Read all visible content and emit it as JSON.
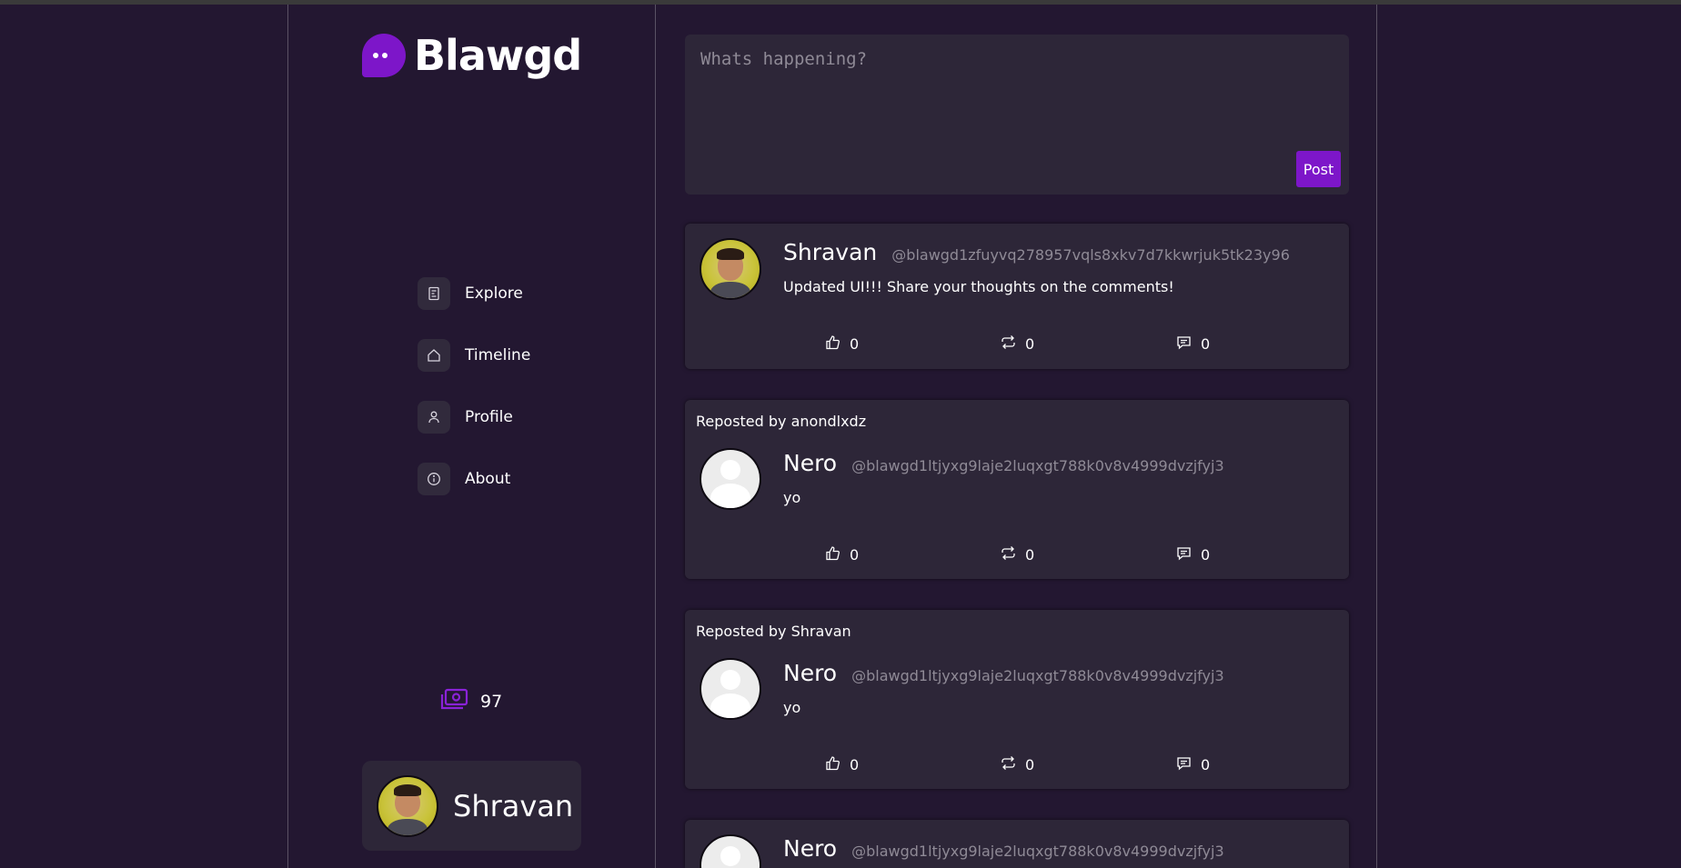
{
  "app": {
    "name": "Blawgd",
    "brand_color": "#7d16c9",
    "background": "#231731"
  },
  "sidebar": {
    "items": [
      {
        "label": "Explore",
        "icon": "explore-icon"
      },
      {
        "label": "Timeline",
        "icon": "home-icon"
      },
      {
        "label": "Profile",
        "icon": "user-icon"
      },
      {
        "label": "About",
        "icon": "info-icon"
      }
    ],
    "coins": {
      "icon": "money-icon",
      "value": "97"
    },
    "user": {
      "name": "Shravan"
    }
  },
  "composer": {
    "placeholder": "Whats happening?",
    "post_label": "Post"
  },
  "feed": [
    {
      "reposted_by": "",
      "name": "Shravan",
      "handle": "@blawgd1zfuyvq278957vqls8xkv7d7kkwrjuk5tk23y96",
      "text": "Updated UI!!! Share your thoughts on the comments!",
      "likes": "0",
      "reposts": "0",
      "comments": "0"
    },
    {
      "reposted_by": "Reposted by anondlxdz",
      "name": "Nero",
      "handle": "@blawgd1ltjyxg9laje2luqxgt788k0v8v4999dvzjfyj3",
      "text": "yo",
      "likes": "0",
      "reposts": "0",
      "comments": "0"
    },
    {
      "reposted_by": "Reposted by Shravan",
      "name": "Nero",
      "handle": "@blawgd1ltjyxg9laje2luqxgt788k0v8v4999dvzjfyj3",
      "text": "yo",
      "likes": "0",
      "reposts": "0",
      "comments": "0"
    },
    {
      "reposted_by": "",
      "name": "Nero",
      "handle": "@blawgd1ltjyxg9laje2luqxgt788k0v8v4999dvzjfyj3",
      "text": "",
      "likes": "",
      "reposts": "",
      "comments": ""
    }
  ]
}
